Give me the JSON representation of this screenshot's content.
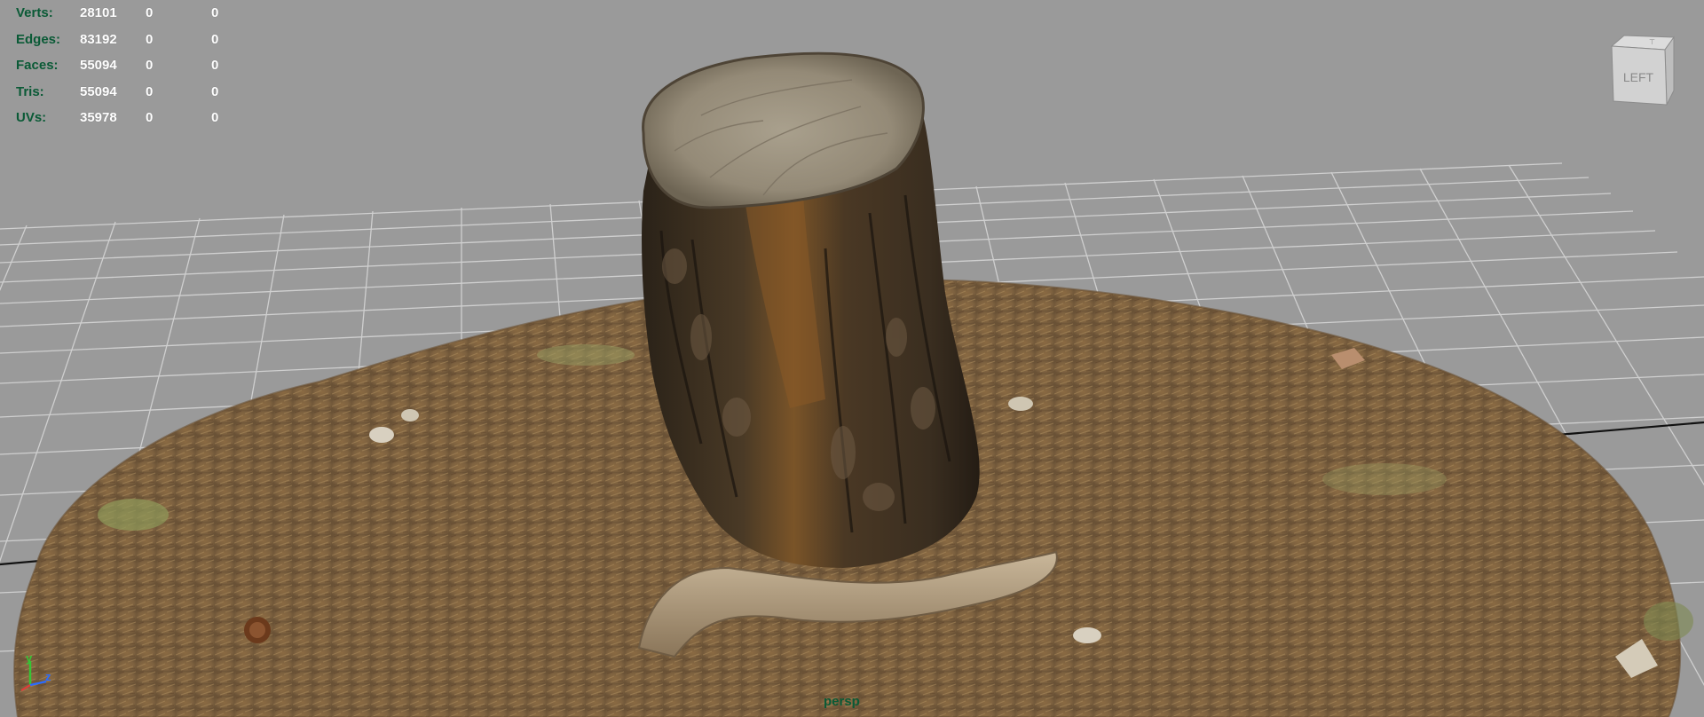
{
  "hud": {
    "rows": [
      {
        "label": "Verts:",
        "v1": "28101",
        "v2": "0",
        "v3": "0"
      },
      {
        "label": "Edges:",
        "v1": "83192",
        "v2": "0",
        "v3": "0"
      },
      {
        "label": "Faces:",
        "v1": "55094",
        "v2": "0",
        "v3": "0"
      },
      {
        "label": "Tris:",
        "v1": "55094",
        "v2": "0",
        "v3": "0"
      },
      {
        "label": "UVs:",
        "v1": "35978",
        "v2": "0",
        "v3": "0"
      }
    ]
  },
  "view_cube": {
    "face_label": "LEFT"
  },
  "camera": {
    "label": "persp"
  },
  "axis": {
    "y": "y",
    "z": "z"
  },
  "colors": {
    "hud_label": "#0a5a36",
    "background": "#9a9a9a",
    "grid": "#cfcfcf"
  }
}
